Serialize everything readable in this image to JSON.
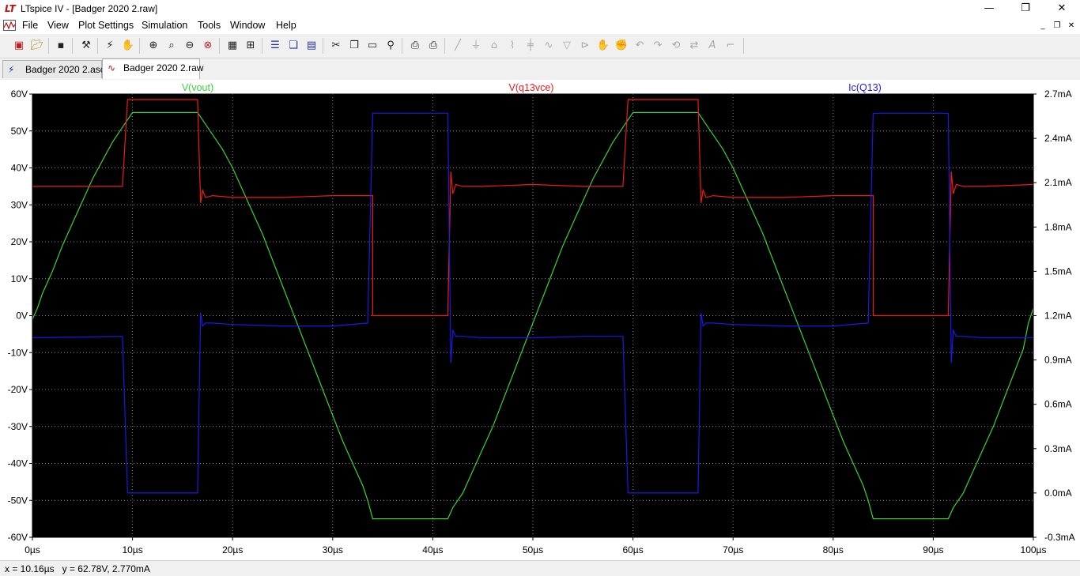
{
  "window": {
    "title": "LTspice IV - [Badger 2020 2.raw]",
    "minimize": "—",
    "maximize": "❐",
    "close": "✕"
  },
  "menu": {
    "items": [
      "File",
      "View",
      "Plot Settings",
      "Simulation",
      "Tools",
      "Window",
      "Help"
    ]
  },
  "toolbar": {
    "icons": [
      "new-schematic-icon",
      "open-icon",
      "save-icon",
      "control-panel-icon",
      "run-icon",
      "pan-icon",
      "zoom-in-icon",
      "zoom-box-icon",
      "zoom-out-icon",
      "zoom-fit-icon",
      "autorange-icon",
      "grid-icon",
      "tile-horizontal-icon",
      "cascade-icon",
      "tile-vertical-icon",
      "cut-icon",
      "copy-icon",
      "paste-icon",
      "find-icon",
      "print-preview-icon",
      "print-icon",
      "wire-icon",
      "ground-icon",
      "label-icon",
      "resistor-icon",
      "capacitor-icon",
      "inductor-icon",
      "diode-icon",
      "component-icon",
      "move-icon",
      "drag-icon",
      "undo-icon",
      "redo-icon",
      "rotate-icon",
      "mirror-icon",
      "text-icon",
      "spice-directive-icon"
    ]
  },
  "tabs": [
    {
      "label": "Badger 2020 2.asc",
      "icon": "schematic-icon",
      "active": false
    },
    {
      "label": "Badger 2020 2.raw",
      "icon": "waveform-icon",
      "active": true
    }
  ],
  "status": {
    "text": "x = 10.16µs   y = 62.78V, 2.770mA"
  },
  "colors": {
    "background": "#000000",
    "grid": "#8a8a8a",
    "vout": "#3ad23a",
    "vce": "#ee1a1a",
    "ic": "#1a1ae8"
  },
  "chart_data": {
    "type": "line",
    "x_unit": "µs",
    "x_range": [
      0,
      100
    ],
    "x_ticks": [
      "0µs",
      "10µs",
      "20µs",
      "30µs",
      "40µs",
      "50µs",
      "60µs",
      "70µs",
      "80µs",
      "90µs",
      "100µs"
    ],
    "y_left_range": [
      -60,
      60
    ],
    "y_left_ticks": [
      "60V",
      "50V",
      "40V",
      "30V",
      "20V",
      "10V",
      "0V",
      "-10V",
      "-20V",
      "-30V",
      "-40V",
      "-50V",
      "-60V"
    ],
    "y_right_range": [
      -0.3,
      2.7
    ],
    "y_right_ticks": [
      "2.7mA",
      "2.4mA",
      "2.1mA",
      "1.8mA",
      "1.5mA",
      "1.2mA",
      "0.9mA",
      "0.6mA",
      "0.3mA",
      "0.0mA",
      "-0.3mA"
    ],
    "grid": true,
    "series": [
      {
        "name": "V(vout)",
        "axis": "left",
        "color": "#3ad23a",
        "x": [
          0,
          0.5,
          1,
          2,
          3,
          4,
          5,
          6,
          7,
          8,
          9,
          9.5,
          10,
          16.5,
          17,
          18,
          19,
          20,
          21,
          22,
          23,
          24,
          25,
          26,
          27,
          28,
          29,
          30,
          31,
          32,
          33,
          33.5,
          34,
          41.5,
          42,
          43,
          44,
          45,
          46,
          47,
          48,
          49,
          50,
          51,
          52,
          53,
          54,
          55,
          56,
          57,
          58,
          59,
          59.5,
          60,
          66.5,
          67,
          68,
          69,
          70,
          71,
          72,
          73,
          74,
          75,
          76,
          77,
          78,
          79,
          80,
          81,
          82,
          83,
          83.5,
          84,
          91.5,
          92,
          93,
          94,
          95,
          96,
          97,
          98,
          99,
          99.5,
          100
        ],
        "y": [
          -1,
          2,
          6,
          12,
          19,
          25,
          31,
          37,
          42,
          47,
          51,
          53,
          55,
          55,
          53,
          49,
          45,
          40,
          34,
          28,
          22,
          15,
          8,
          1,
          -6,
          -13,
          -20,
          -27,
          -34,
          -40,
          -46,
          -50,
          -55,
          -55,
          -52,
          -48,
          -42,
          -36,
          -30,
          -23,
          -16,
          -9,
          -2,
          5,
          12,
          19,
          25,
          31,
          37,
          42,
          47,
          51,
          53,
          55,
          55,
          53,
          49,
          45,
          40,
          34,
          28,
          22,
          15,
          8,
          1,
          -6,
          -13,
          -20,
          -27,
          -34,
          -40,
          -46,
          -50,
          -55,
          -55,
          -52,
          -48,
          -42,
          -36,
          -30,
          -23,
          -16,
          -9,
          -2,
          2
        ]
      },
      {
        "name": "V(q13vce)",
        "axis": "left",
        "color": "#ee1a1a",
        "x": [
          0,
          9,
          9.5,
          16.5,
          16.8,
          17,
          17.3,
          18,
          20,
          25,
          30,
          33.5,
          34,
          34,
          41.5,
          41.8,
          42,
          42.3,
          43,
          45,
          50,
          55,
          59,
          59.5,
          66.5,
          66.8,
          67,
          67.3,
          68,
          70,
          75,
          80,
          83.5,
          84,
          84,
          91.5,
          91.8,
          92,
          92.3,
          93,
          95,
          100
        ],
        "y": [
          35,
          35,
          58.5,
          58.5,
          30.5,
          34,
          32,
          32.5,
          32,
          32,
          32.5,
          32.5,
          32.5,
          0,
          0,
          39,
          33,
          35.5,
          35,
          35,
          35.5,
          35,
          35,
          58.5,
          58.5,
          30.5,
          34,
          32,
          32.5,
          32,
          32,
          32.5,
          32.5,
          32.5,
          0,
          0,
          39,
          33,
          35.5,
          35,
          35,
          35.5
        ]
      },
      {
        "name": "Ic(Q13)",
        "axis": "right",
        "color": "#1a1ae8",
        "x": [
          0,
          9,
          9.5,
          16.5,
          16.8,
          17,
          17.3,
          18,
          20,
          25,
          30,
          33.5,
          34,
          41.5,
          41.8,
          42,
          42.3,
          43,
          45,
          50,
          55,
          59,
          59.5,
          66.5,
          66.8,
          67,
          67.3,
          68,
          70,
          75,
          80,
          83.5,
          84,
          91.5,
          91.8,
          92,
          92.3,
          93,
          95,
          100
        ],
        "y": [
          1.05,
          1.06,
          0.0,
          0.0,
          1.22,
          1.13,
          1.15,
          1.15,
          1.14,
          1.13,
          1.13,
          1.15,
          2.57,
          2.57,
          0.88,
          1.1,
          1.06,
          1.06,
          1.05,
          1.05,
          1.06,
          1.06,
          0.0,
          0.0,
          1.22,
          1.13,
          1.15,
          1.15,
          1.14,
          1.13,
          1.13,
          1.15,
          2.57,
          2.57,
          0.88,
          1.1,
          1.06,
          1.06,
          1.05,
          1.05
        ]
      }
    ]
  }
}
